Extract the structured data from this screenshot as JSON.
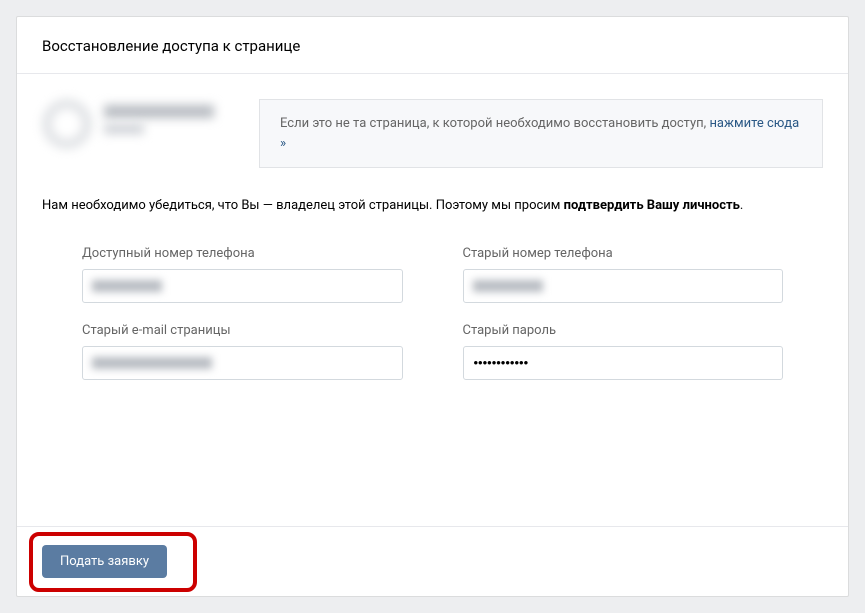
{
  "header": {
    "title": "Восстановление доступа к странице"
  },
  "notice": {
    "text_before": "Если это не та страница, к которой необходимо восстановить доступ, ",
    "link_text": "нажмите сюда »"
  },
  "intro": {
    "text_part1": "Нам необходимо убедиться, что Вы — владелец этой страницы. Поэтому мы просим ",
    "text_strong": "подтвердить Вашу личность",
    "text_after": "."
  },
  "form": {
    "available_phone": {
      "label": "Доступный номер телефона",
      "value": ""
    },
    "old_phone": {
      "label": "Старый номер телефона",
      "value": ""
    },
    "old_email": {
      "label": "Старый e-mail страницы",
      "value": ""
    },
    "old_password": {
      "label": "Старый пароль",
      "value": "••••••••••••"
    }
  },
  "footer": {
    "submit_label": "Подать заявку"
  }
}
